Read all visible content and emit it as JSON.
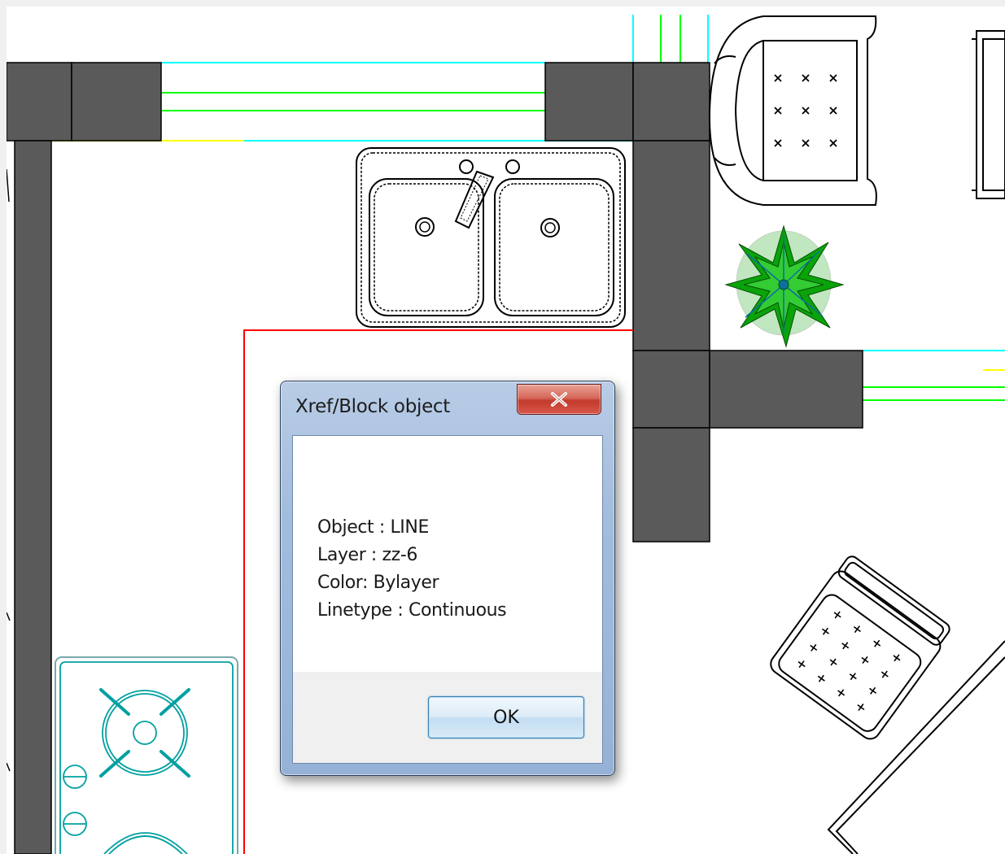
{
  "dialog": {
    "title": "Xref/Block object",
    "close_symbol": "x",
    "object_line": "Object : LINE",
    "layer_line": "Layer : zz-6",
    "color_line": "Color: Bylayer",
    "linetype_line": "Linetype : Continuous",
    "ok_label": "OK"
  },
  "drawing": {
    "background": "#ffffff",
    "wall_fill": "#5a5a5a",
    "line_colors": {
      "cyan": "#00ffff",
      "green": "#00ff00",
      "yellow": "#ffff00",
      "red": "#ff0000",
      "teal": "#00a0a0",
      "plant_green": "#0aa30a"
    },
    "symbols": [
      "double-sink",
      "armchair",
      "potted-plant",
      "stove",
      "chair",
      "table-corner"
    ]
  }
}
